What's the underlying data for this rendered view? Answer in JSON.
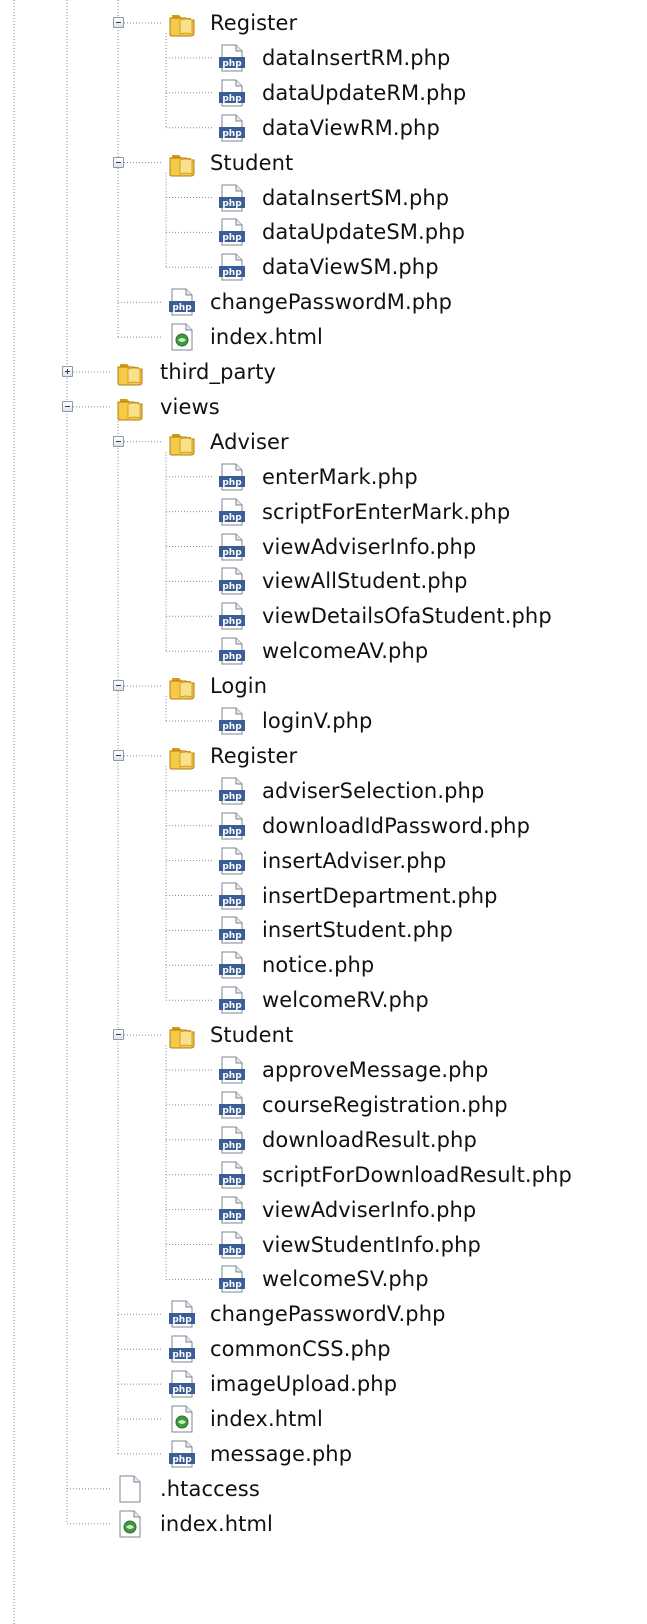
{
  "tree": {
    "rows": [
      {
        "label": "Register",
        "icon": "folder-icon",
        "toggle": "expanded",
        "depth": 2
      },
      {
        "label": "dataInsertRM.php",
        "icon": "php-file-icon",
        "toggle": "none",
        "depth": 3
      },
      {
        "label": "dataUpdateRM.php",
        "icon": "php-file-icon",
        "toggle": "none",
        "depth": 3
      },
      {
        "label": "dataViewRM.php",
        "icon": "php-file-icon",
        "toggle": "none",
        "depth": 3
      },
      {
        "label": "Student",
        "icon": "folder-icon",
        "toggle": "expanded",
        "depth": 2
      },
      {
        "label": "dataInsertSM.php",
        "icon": "php-file-icon",
        "toggle": "none",
        "depth": 3
      },
      {
        "label": "dataUpdateSM.php",
        "icon": "php-file-icon",
        "toggle": "none",
        "depth": 3
      },
      {
        "label": "dataViewSM.php",
        "icon": "php-file-icon",
        "toggle": "none",
        "depth": 3
      },
      {
        "label": "changePasswordM.php",
        "icon": "php-file-icon",
        "toggle": "none",
        "depth": 2
      },
      {
        "label": "index.html",
        "icon": "html-file-icon",
        "toggle": "none",
        "depth": 2
      },
      {
        "label": "third_party",
        "icon": "folder-icon",
        "toggle": "collapsed",
        "depth": 1
      },
      {
        "label": "views",
        "icon": "folder-icon",
        "toggle": "expanded",
        "depth": 1
      },
      {
        "label": "Adviser",
        "icon": "folder-icon",
        "toggle": "expanded",
        "depth": 2
      },
      {
        "label": "enterMark.php",
        "icon": "php-file-icon",
        "toggle": "none",
        "depth": 3
      },
      {
        "label": "scriptForEnterMark.php",
        "icon": "php-file-icon",
        "toggle": "none",
        "depth": 3
      },
      {
        "label": "viewAdviserInfo.php",
        "icon": "php-file-icon",
        "toggle": "none",
        "depth": 3
      },
      {
        "label": "viewAllStudent.php",
        "icon": "php-file-icon",
        "toggle": "none",
        "depth": 3
      },
      {
        "label": "viewDetailsOfaStudent.php",
        "icon": "php-file-icon",
        "toggle": "none",
        "depth": 3
      },
      {
        "label": "welcomeAV.php",
        "icon": "php-file-icon",
        "toggle": "none",
        "depth": 3
      },
      {
        "label": "Login",
        "icon": "folder-icon",
        "toggle": "expanded",
        "depth": 2
      },
      {
        "label": "loginV.php",
        "icon": "php-file-icon",
        "toggle": "none",
        "depth": 3
      },
      {
        "label": "Register",
        "icon": "folder-icon",
        "toggle": "expanded",
        "depth": 2
      },
      {
        "label": "adviserSelection.php",
        "icon": "php-file-icon",
        "toggle": "none",
        "depth": 3
      },
      {
        "label": "downloadIdPassword.php",
        "icon": "php-file-icon",
        "toggle": "none",
        "depth": 3
      },
      {
        "label": "insertAdviser.php",
        "icon": "php-file-icon",
        "toggle": "none",
        "depth": 3
      },
      {
        "label": "insertDepartment.php",
        "icon": "php-file-icon",
        "toggle": "none",
        "depth": 3
      },
      {
        "label": "insertStudent.php",
        "icon": "php-file-icon",
        "toggle": "none",
        "depth": 3
      },
      {
        "label": "notice.php",
        "icon": "php-file-icon",
        "toggle": "none",
        "depth": 3
      },
      {
        "label": "welcomeRV.php",
        "icon": "php-file-icon",
        "toggle": "none",
        "depth": 3
      },
      {
        "label": "Student",
        "icon": "folder-icon",
        "toggle": "expanded",
        "depth": 2
      },
      {
        "label": "approveMessage.php",
        "icon": "php-file-icon",
        "toggle": "none",
        "depth": 3
      },
      {
        "label": "courseRegistration.php",
        "icon": "php-file-icon",
        "toggle": "none",
        "depth": 3
      },
      {
        "label": "downloadResult.php",
        "icon": "php-file-icon",
        "toggle": "none",
        "depth": 3
      },
      {
        "label": "scriptForDownloadResult.php",
        "icon": "php-file-icon",
        "toggle": "none",
        "depth": 3
      },
      {
        "label": "viewAdviserInfo.php",
        "icon": "php-file-icon",
        "toggle": "none",
        "depth": 3
      },
      {
        "label": "viewStudentInfo.php",
        "icon": "php-file-icon",
        "toggle": "none",
        "depth": 3
      },
      {
        "label": "welcomeSV.php",
        "icon": "php-file-icon",
        "toggle": "none",
        "depth": 3
      },
      {
        "label": "changePasswordV.php",
        "icon": "php-file-icon",
        "toggle": "none",
        "depth": 2
      },
      {
        "label": "commonCSS.php",
        "icon": "php-file-icon",
        "toggle": "none",
        "depth": 2
      },
      {
        "label": "imageUpload.php",
        "icon": "php-file-icon",
        "toggle": "none",
        "depth": 2
      },
      {
        "label": "index.html",
        "icon": "html-file-icon",
        "toggle": "none",
        "depth": 2
      },
      {
        "label": "message.php",
        "icon": "php-file-icon",
        "toggle": "none",
        "depth": 2
      },
      {
        "label": ".htaccess",
        "icon": "blank-file-icon",
        "toggle": "none",
        "depth": 1
      },
      {
        "label": "index.html",
        "icon": "html-file-icon",
        "toggle": "none",
        "depth": 1
      }
    ]
  },
  "icons": {
    "php_badge_text": "php"
  },
  "colors": {
    "folder_fill": "#f7c948",
    "folder_dark": "#d79b12",
    "guide_line": "#8a8a8a",
    "php_badge": "#3b5f94",
    "html_badge": "#3f9a3f"
  }
}
